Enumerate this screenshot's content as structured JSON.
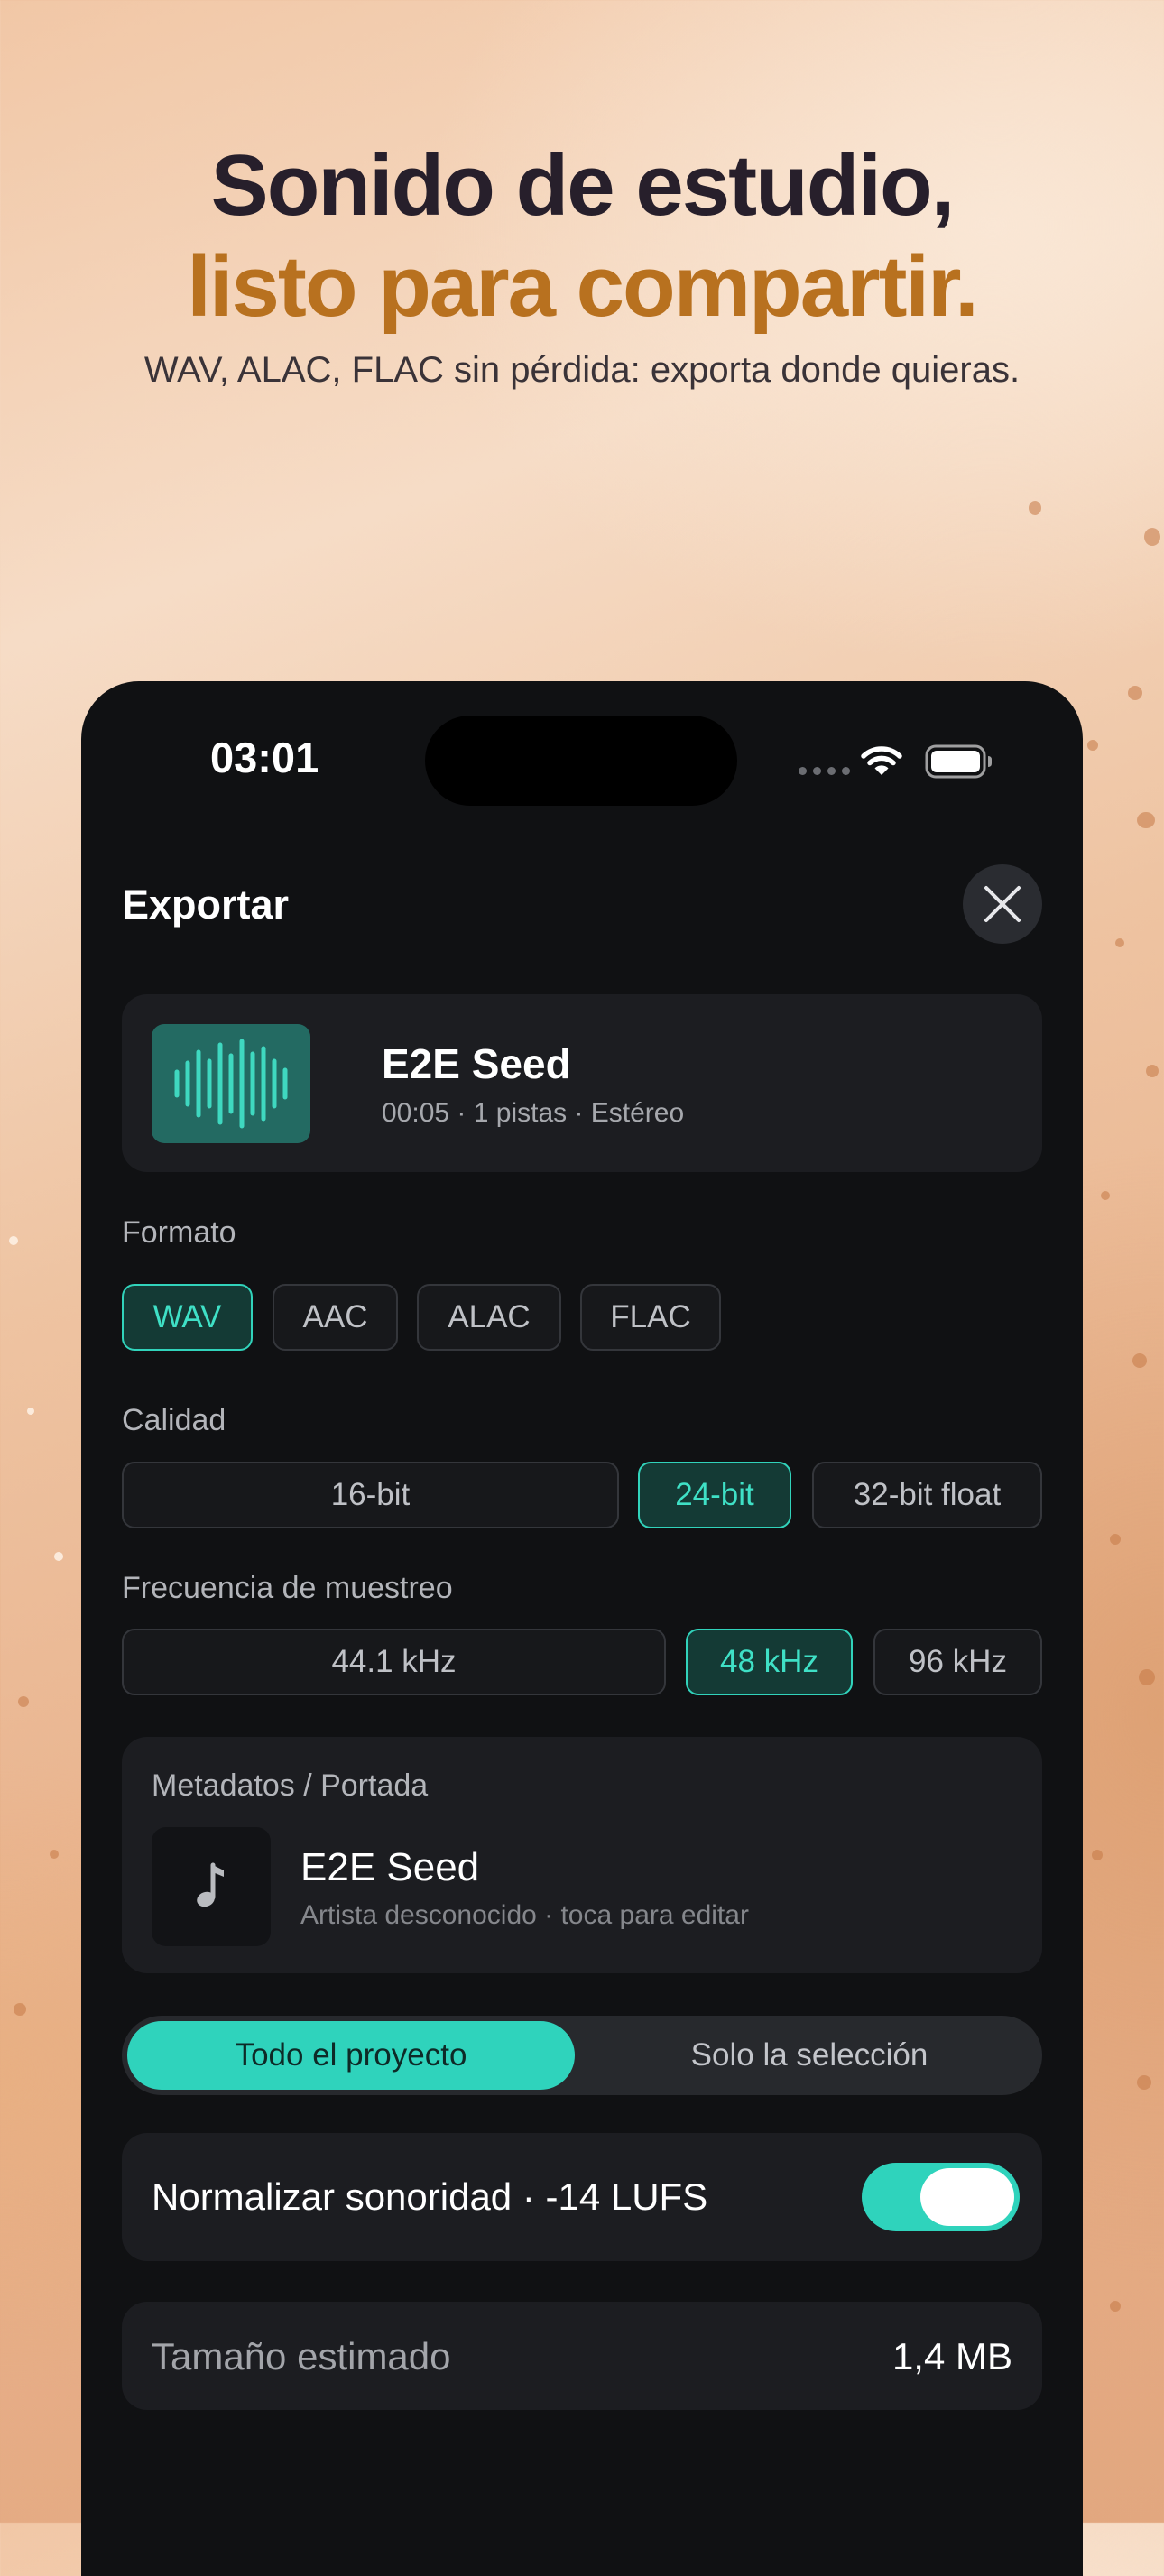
{
  "hero": {
    "line1": "Sonido de estudio,",
    "line2": "listo para compartir.",
    "subtitle": "WAV, ALAC, FLAC sin pérdida: exporta donde quieras."
  },
  "status_bar": {
    "time": "03:01"
  },
  "sheet": {
    "title": "Exportar"
  },
  "track": {
    "title": "E2E Seed",
    "meta": "00:05 · 1 pistas · Estéreo"
  },
  "format": {
    "label": "Formato",
    "options": [
      "WAV",
      "AAC",
      "ALAC",
      "FLAC"
    ],
    "selected": "WAV"
  },
  "quality": {
    "label": "Calidad",
    "options": [
      "16-bit",
      "24-bit",
      "32-bit float"
    ],
    "selected": "24-bit"
  },
  "sample_rate": {
    "label": "Frecuencia de muestreo",
    "options": [
      "44.1 kHz",
      "48 kHz",
      "96 kHz"
    ],
    "selected": "48 kHz"
  },
  "metadata": {
    "label": "Metadatos / Portada",
    "title": "E2E Seed",
    "subtitle": "Artista desconocido · toca para editar"
  },
  "scope": {
    "options": [
      "Todo el proyecto",
      "Solo la selección"
    ],
    "selected": "Todo el proyecto"
  },
  "normalize": {
    "label": "Normalizar sonoridad · -14 LUFS",
    "enabled": true
  },
  "estimate": {
    "label": "Tamaño estimado",
    "value": "1,4 MB"
  },
  "colors": {
    "accent": "#2fd3bc",
    "hero_highlight": "#b8711f",
    "sheet_background": "#101113"
  }
}
